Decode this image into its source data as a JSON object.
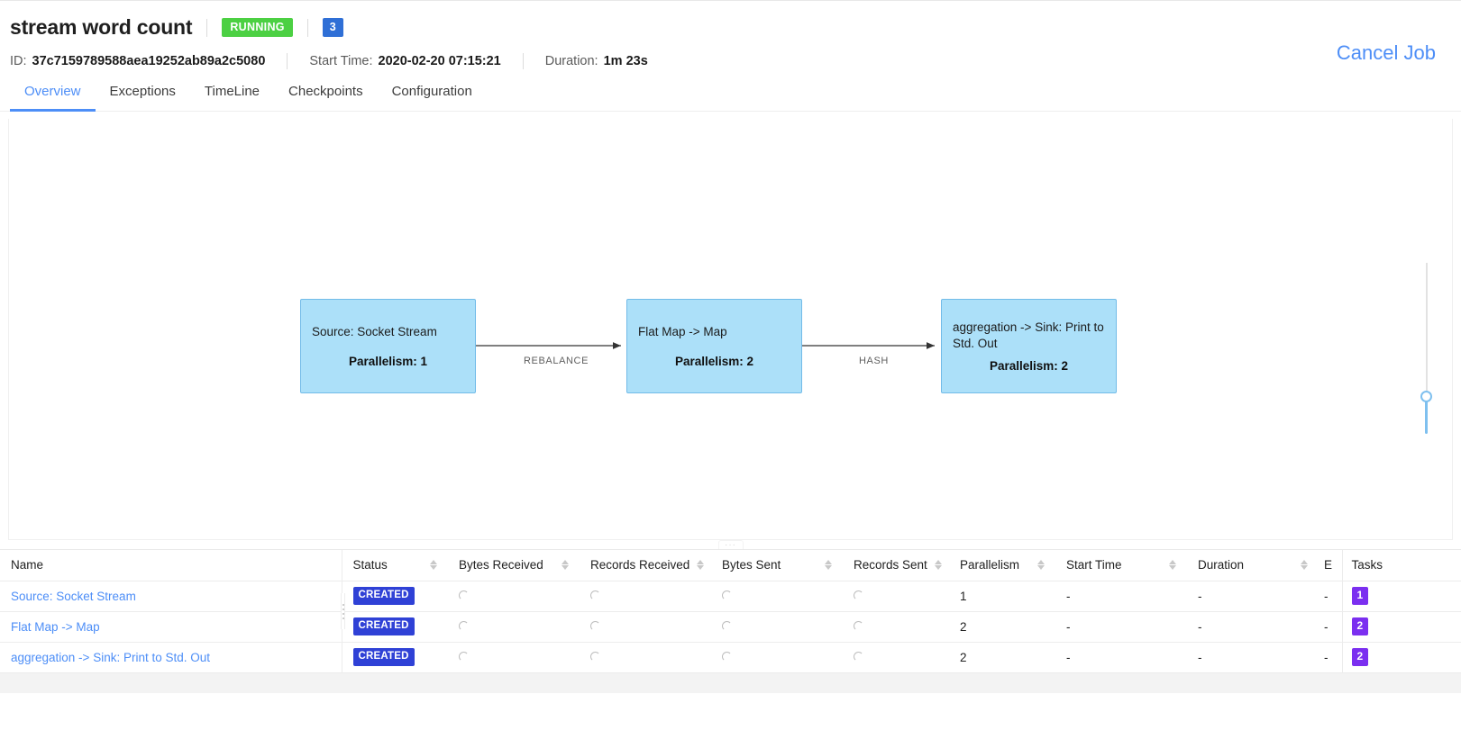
{
  "header": {
    "title": "stream word count",
    "status_badge": "RUNNING",
    "count_badge": "3",
    "id_label": "ID:",
    "id_value": "37c7159789588aea19252ab89a2c5080",
    "start_time_label": "Start Time:",
    "start_time_value": "2020-02-20 07:15:21",
    "duration_label": "Duration:",
    "duration_value": "1m 23s",
    "cancel_job": "Cancel Job"
  },
  "tabs": [
    {
      "label": "Overview",
      "active": true
    },
    {
      "label": "Exceptions",
      "active": false
    },
    {
      "label": "TimeLine",
      "active": false
    },
    {
      "label": "Checkpoints",
      "active": false
    },
    {
      "label": "Configuration",
      "active": false
    }
  ],
  "graph": {
    "nodes": [
      {
        "title": "Source: Socket Stream",
        "parallelism": "Parallelism: 1"
      },
      {
        "title": "Flat Map -> Map",
        "parallelism": "Parallelism: 2"
      },
      {
        "title": "aggregation -> Sink: Print to Std. Out",
        "parallelism": "Parallelism: 2"
      }
    ],
    "edges": [
      {
        "label": "REBALANCE"
      },
      {
        "label": "HASH"
      }
    ],
    "drag_handle": "···"
  },
  "table": {
    "columns": [
      "Name",
      "Status",
      "Bytes Received",
      "Records Received",
      "Bytes Sent",
      "Records Sent",
      "Parallelism",
      "Start Time",
      "Duration",
      "E",
      "Tasks"
    ],
    "rows": [
      {
        "name": "Source: Socket Stream",
        "status": "CREATED",
        "bytes_received": "",
        "records_received": "",
        "bytes_sent": "",
        "records_sent": "",
        "parallelism": "1",
        "start_time": "-",
        "duration": "-",
        "end_time": "-",
        "tasks": "1"
      },
      {
        "name": "Flat Map -> Map",
        "status": "CREATED",
        "bytes_received": "",
        "records_received": "",
        "bytes_sent": "",
        "records_sent": "",
        "parallelism": "2",
        "start_time": "-",
        "duration": "-",
        "end_time": "-",
        "tasks": "2"
      },
      {
        "name": "aggregation -> Sink: Print to Std. Out",
        "status": "CREATED",
        "bytes_received": "",
        "records_received": "",
        "bytes_sent": "",
        "records_sent": "",
        "parallelism": "2",
        "start_time": "-",
        "duration": "-",
        "end_time": "-",
        "tasks": "2"
      }
    ]
  },
  "colors": {
    "accent": "#4d8ef7",
    "running_green": "#4cd043",
    "created_blue": "#2f41d6",
    "tasks_purple": "#7b2ff0",
    "node_fill": "#ace0f9",
    "node_border": "#72bbe8"
  }
}
